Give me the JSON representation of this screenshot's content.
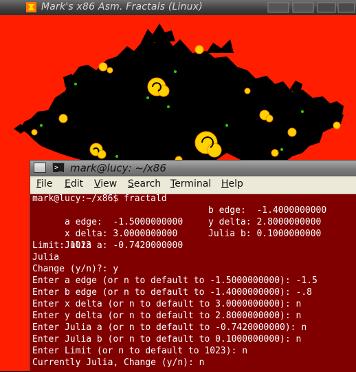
{
  "window": {
    "title": "Mark's x86 Asm. Fractals (Linux)"
  },
  "terminal": {
    "title": "mark@lucy: ~/x86",
    "menu": [
      {
        "mnemonic": "F",
        "rest": "ile"
      },
      {
        "mnemonic": "E",
        "rest": "dit"
      },
      {
        "mnemonic": "V",
        "rest": "iew"
      },
      {
        "mnemonic": "S",
        "rest": "earch"
      },
      {
        "mnemonic": "T",
        "rest": "erminal"
      },
      {
        "mnemonic": "H",
        "rest": "elp"
      }
    ],
    "prompt_line": "mark@lucy:~/x86$ fractald",
    "params": [
      {
        "left": "a edge:  -1.5000000000",
        "right": "b edge:  -1.4000000000"
      },
      {
        "left": "x delta: 3.0000000000",
        "right": "y delta: 2.8000000000"
      },
      {
        "left": "Julia a: -0.7420000000",
        "right": "Julia b: 0.1000000000"
      }
    ],
    "lines": [
      "Limit: 1023",
      "Julia",
      "Change (y/n)?: y",
      "Enter a edge (or n to default to -1.5000000000): -1.5",
      "Enter b edge (or n to default to -1.4000000000): -.8",
      "Enter x delta (or n to default to 3.0000000000): n",
      "Enter y delta (or n to default to 2.8000000000): n",
      "Enter Julia a (or n to default to -0.7420000000): n",
      "Enter Julia b (or n to default to 0.1000000000): n",
      "Enter Limit (or n to default to 1023): n",
      "Currently Julia, Change (y/n): n"
    ]
  },
  "colors": {
    "fractal_background": "#ff1e00",
    "fractal_set": "#000000",
    "spiral_yellow": "#ffd200",
    "spiral_green": "#2ecc00",
    "terminal_background": "#800000",
    "terminal_text": "#ffffff"
  }
}
